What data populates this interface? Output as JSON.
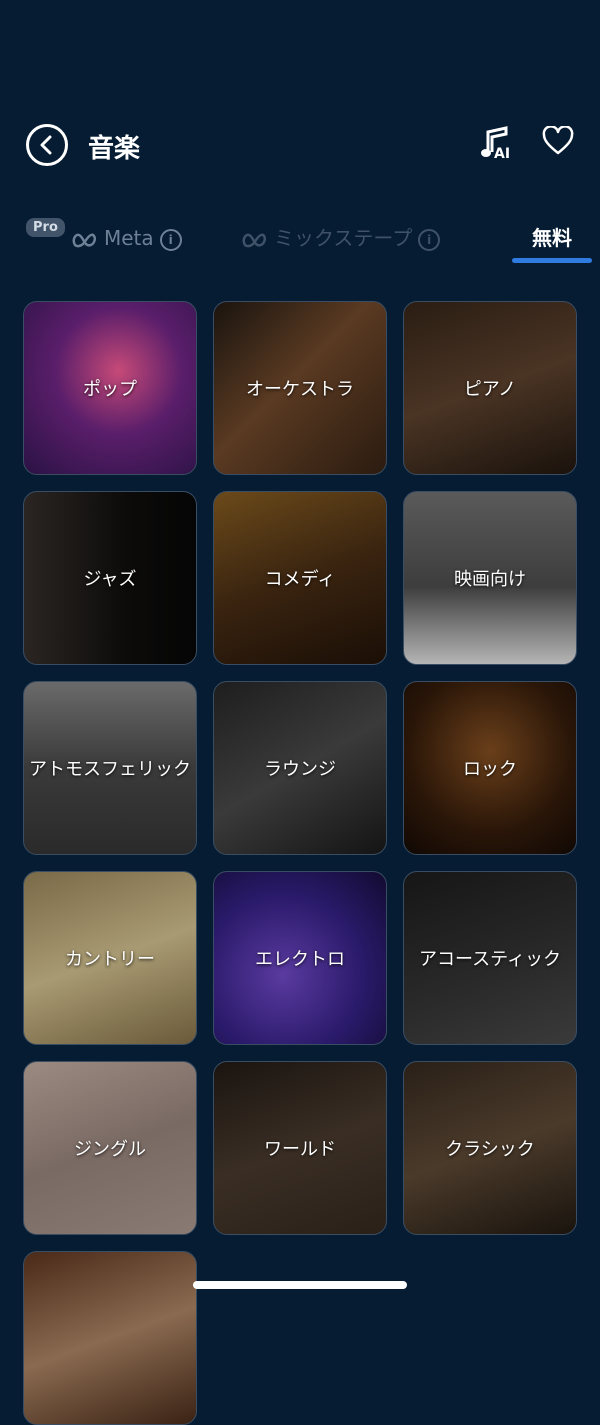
{
  "header": {
    "title": "音楽",
    "ai_badge": "AI",
    "icons": [
      "back-icon",
      "ai-music-icon",
      "heart-icon"
    ]
  },
  "tabs": [
    {
      "badge": "Pro",
      "label": "Meta",
      "icon": "meta-logo-icon"
    },
    {
      "label": "ミックステープ",
      "icon": "meta-logo-icon"
    },
    {
      "label": "無料",
      "selected": true
    }
  ],
  "categories": [
    {
      "label": "ポップ"
    },
    {
      "label": "オーケストラ"
    },
    {
      "label": "ピアノ"
    },
    {
      "label": "ジャズ"
    },
    {
      "label": "コメディ"
    },
    {
      "label": "映画向け"
    },
    {
      "label": "アトモスフェリック"
    },
    {
      "label": "ラウンジ"
    },
    {
      "label": "ロック"
    },
    {
      "label": "カントリー"
    },
    {
      "label": "エレクトロ"
    },
    {
      "label": "アコースティック"
    },
    {
      "label": "ジングル"
    },
    {
      "label": "ワールド"
    },
    {
      "label": "クラシック"
    },
    {
      "label": ""
    }
  ],
  "colors": {
    "background": "#051c33",
    "accent": "#2f7be0"
  }
}
